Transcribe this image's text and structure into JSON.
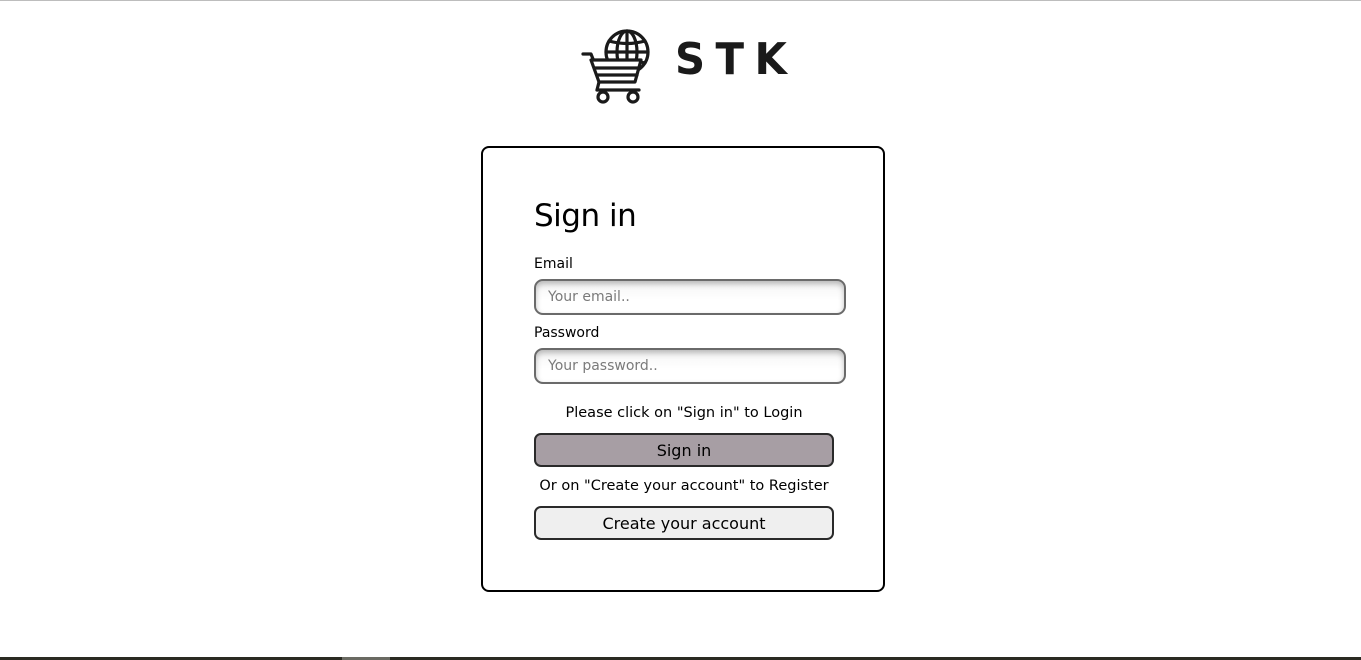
{
  "brand": {
    "name": "STK",
    "logo_icon": "globe-cart-icon"
  },
  "signin_form": {
    "title": "Sign in",
    "email": {
      "label": "Email",
      "placeholder": "Your email..",
      "value": ""
    },
    "password": {
      "label": "Password",
      "placeholder": "Your password..",
      "value": ""
    },
    "login_hint": "Please click on \"Sign in\" to Login",
    "signin_button": "Sign in",
    "register_hint": "Or on \"Create your account\" to Register",
    "create_account_button": "Create your account"
  },
  "colors": {
    "signin_button_bg": "#a79ea4",
    "create_button_bg": "#efefef",
    "card_border": "#000000"
  }
}
